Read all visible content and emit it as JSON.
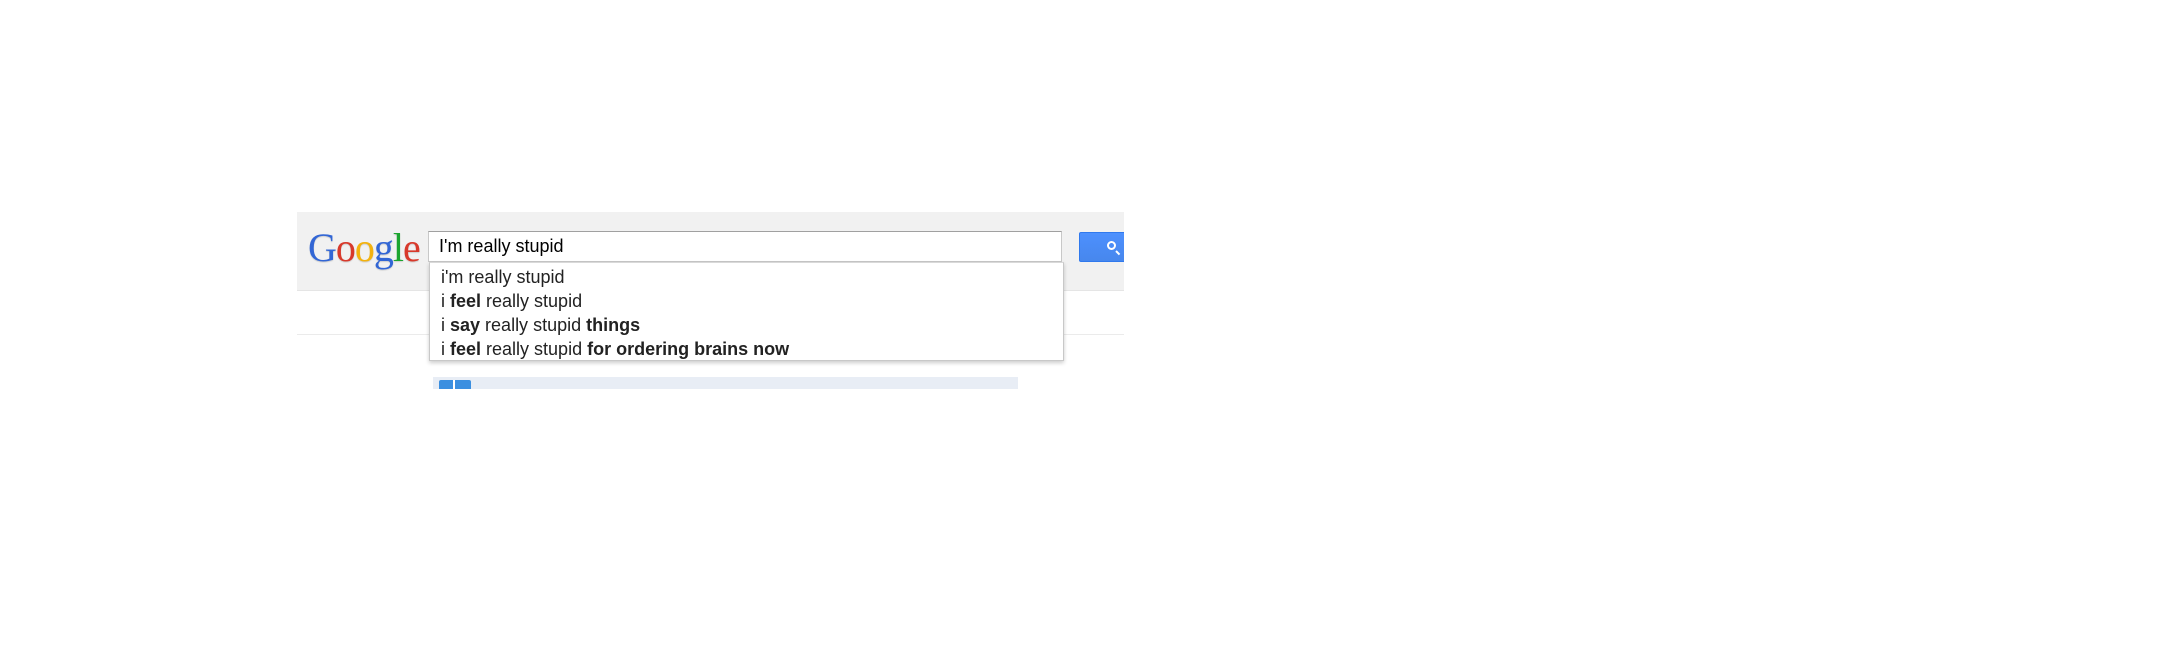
{
  "logo": {
    "letters": [
      "G",
      "o",
      "o",
      "g",
      "l",
      "e"
    ],
    "colors": [
      "#3266d5",
      "#d8392b",
      "#f3b20e",
      "#3266d5",
      "#1ba52f",
      "#d8392b"
    ]
  },
  "search": {
    "value": "I'm really stupid",
    "button_icon": "search-icon",
    "button_color": "#4d90fe"
  },
  "suggestions": [
    {
      "parts": [
        {
          "text": "i'm really stupid",
          "bold": false
        }
      ]
    },
    {
      "parts": [
        {
          "text": "i ",
          "bold": false
        },
        {
          "text": "feel",
          "bold": true
        },
        {
          "text": " really stupid",
          "bold": false
        }
      ]
    },
    {
      "parts": [
        {
          "text": "i ",
          "bold": false
        },
        {
          "text": "say",
          "bold": true
        },
        {
          "text": " really stupid ",
          "bold": false
        },
        {
          "text": "things",
          "bold": true
        }
      ]
    },
    {
      "parts": [
        {
          "text": "i ",
          "bold": false
        },
        {
          "text": "feel",
          "bold": true
        },
        {
          "text": " really stupid ",
          "bold": false
        },
        {
          "text": "for ordering brains now",
          "bold": true
        }
      ]
    }
  ]
}
